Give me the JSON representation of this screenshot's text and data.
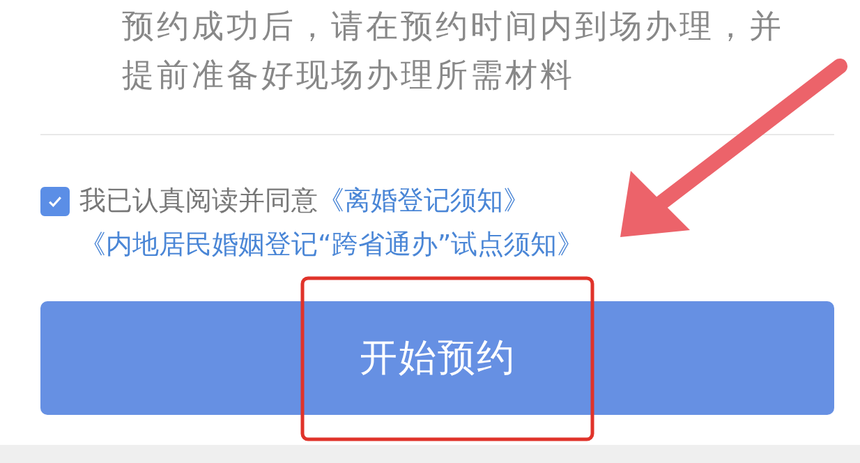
{
  "instructions": "预约成功后，请在预约时间内到场办理，并提前准备好现场办理所需材料",
  "agreement": {
    "checked": true,
    "text": "我已认真阅读并同意",
    "links": [
      "《离婚登记须知》",
      "《内地居民婚姻登记“跨省通办”试点须知》"
    ]
  },
  "button": {
    "label": "开始预约"
  }
}
